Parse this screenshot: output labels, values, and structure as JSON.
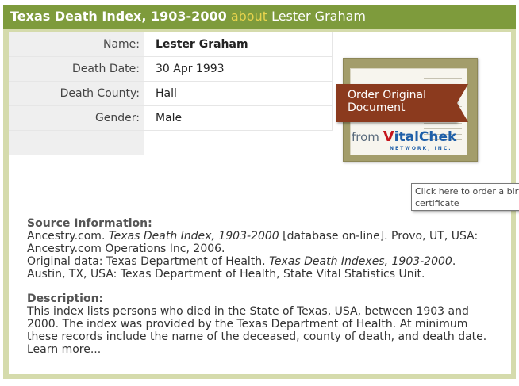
{
  "header": {
    "title": "Texas Death Index, 1903-2000",
    "about": "about",
    "person": "Lester Graham"
  },
  "record": [
    {
      "label": "Name:",
      "value": "Lester Graham"
    },
    {
      "label": "Death Date:",
      "value": "30 Apr 1993"
    },
    {
      "label": "Death County:",
      "value": "Hall"
    },
    {
      "label": "Gender:",
      "value": "Male"
    }
  ],
  "order_card": {
    "ribbon_line1": "Order Original",
    "ribbon_line2": "Document",
    "from": "from",
    "brand_v": "V",
    "brand_rest": "italChek",
    "brand_sub": "NETWORK, INC."
  },
  "tooltip": {
    "line1": "Click here to order a birth",
    "line2": "certificate"
  },
  "source": {
    "heading": "Source Information:",
    "line1_a": "Ancestry.com. ",
    "line1_b": "Texas Death Index, 1903-2000",
    "line1_c": " [database on-line]. Provo, UT, USA:",
    "line2": "Ancestry.com Operations Inc, 2006.",
    "line3_a": "Original data: Texas Department of Health. ",
    "line3_b": "Texas Death Indexes, 1903-2000",
    "line3_c": ".",
    "line4": "Austin, TX, USA: Texas Department of Health, State Vital Statistics Unit."
  },
  "description": {
    "heading": "Description:",
    "line1": "This index lists persons who died in the State of Texas, USA, between 1903 and",
    "line2": "2000. The index was provided by the Texas Department of Health. At minimum",
    "line3": "these records include the name of the deceased, county of death, and death date.",
    "learn_more": "Learn more..."
  },
  "colors": {
    "header_bg": "#7e9b3c",
    "frame_bg": "#d5dbac",
    "about_text": "#e8d44d",
    "ribbon": "#8b3a1e",
    "brand_red": "#c5161d",
    "brand_blue": "#1f5fa8"
  }
}
